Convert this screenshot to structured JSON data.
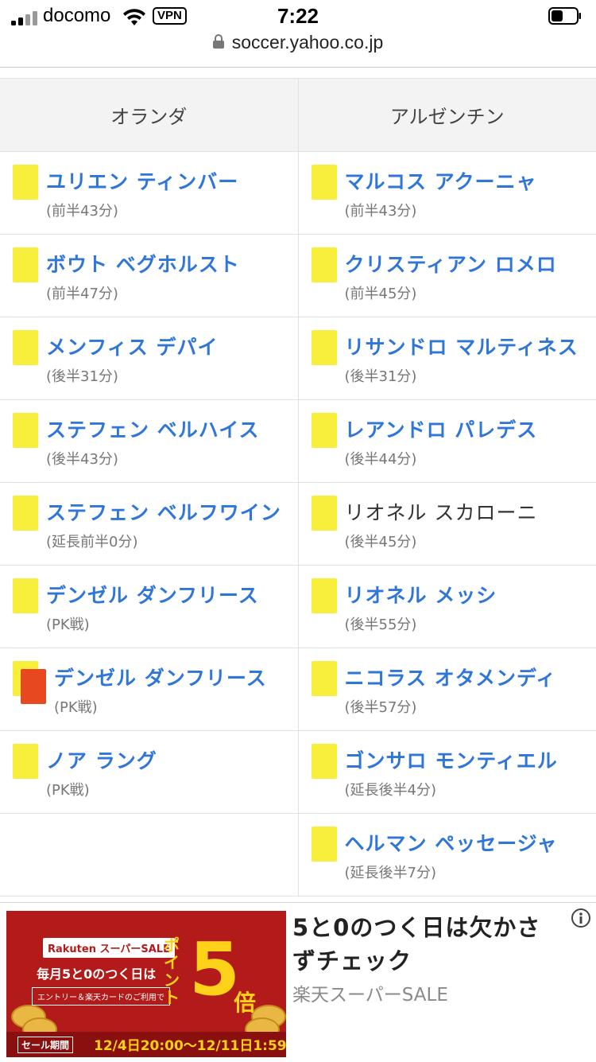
{
  "status_bar": {
    "carrier": "docomo",
    "vpn": "VPN",
    "time": "7:22"
  },
  "url_bar": {
    "domain": "soccer.yahoo.co.jp"
  },
  "table": {
    "headers": [
      "オランダ",
      "アルゼンチン"
    ],
    "rows": [
      {
        "left": {
          "card": "yellow",
          "name": "ユリエン ティンバー",
          "time": "(前半43分)",
          "link": true
        },
        "right": {
          "card": "yellow",
          "name": "マルコス アクーニャ",
          "time": "(前半43分)",
          "link": true
        }
      },
      {
        "left": {
          "card": "yellow",
          "name": "ボウト ベグホルスト",
          "time": "(前半47分)",
          "link": true
        },
        "right": {
          "card": "yellow",
          "name": "クリスティアン ロメロ",
          "time": "(前半45分)",
          "link": true
        }
      },
      {
        "left": {
          "card": "yellow",
          "name": "メンフィス デパイ",
          "time": "(後半31分)",
          "link": true
        },
        "right": {
          "card": "yellow",
          "name": "リサンドロ マルティネス",
          "time": "(後半31分)",
          "link": true
        }
      },
      {
        "left": {
          "card": "yellow",
          "name": "ステフェン ベルハイス",
          "time": "(後半43分)",
          "link": true
        },
        "right": {
          "card": "yellow",
          "name": "レアンドロ パレデス",
          "time": "(後半44分)",
          "link": true
        }
      },
      {
        "left": {
          "card": "yellow",
          "name": "ステフェン ベルフワイン",
          "time": "(延長前半0分)",
          "link": true
        },
        "right": {
          "card": "yellow",
          "name": "リオネル スカローニ",
          "time": "(後半45分)",
          "link": false
        }
      },
      {
        "left": {
          "card": "yellow",
          "name": "デンゼル ダンフリース",
          "time": "(PK戦)",
          "link": true
        },
        "right": {
          "card": "yellow",
          "name": "リオネル メッシ",
          "time": "(後半55分)",
          "link": true
        }
      },
      {
        "left": {
          "card": "yellow-red",
          "name": "デンゼル ダンフリース",
          "time": "(PK戦)",
          "link": true
        },
        "right": {
          "card": "yellow",
          "name": "ニコラス オタメンディ",
          "time": "(後半57分)",
          "link": true
        }
      },
      {
        "left": {
          "card": "yellow",
          "name": "ノア ラング",
          "time": "(PK戦)",
          "link": true
        },
        "right": {
          "card": "yellow",
          "name": "ゴンサロ モンティエル",
          "time": "(延長後半4分)",
          "link": true
        }
      },
      {
        "left": null,
        "right": {
          "card": "yellow",
          "name": "ヘルマン ペッセージャ",
          "time": "(延長後半7分)",
          "link": true
        }
      }
    ]
  },
  "ad": {
    "banner": {
      "brand": "Rakuten スーパーSALE",
      "line1": "毎月5と0のつく日は",
      "line2": "エントリー＆楽天カードのご利用で",
      "points_label": "ポイント",
      "points_value": "5",
      "points_unit": "倍",
      "period_label": "セール期間",
      "period": "12/4日20:00〜12/11日1:59"
    },
    "title": "5と0のつく日は欠かさずチェック",
    "sponsor": "楽天スーパーSALE"
  },
  "colors": {
    "link": "#2f76d8",
    "yellow_card": "#f8ef3c",
    "red_card": "#e8481f",
    "ad_red": "#b31b1b"
  }
}
